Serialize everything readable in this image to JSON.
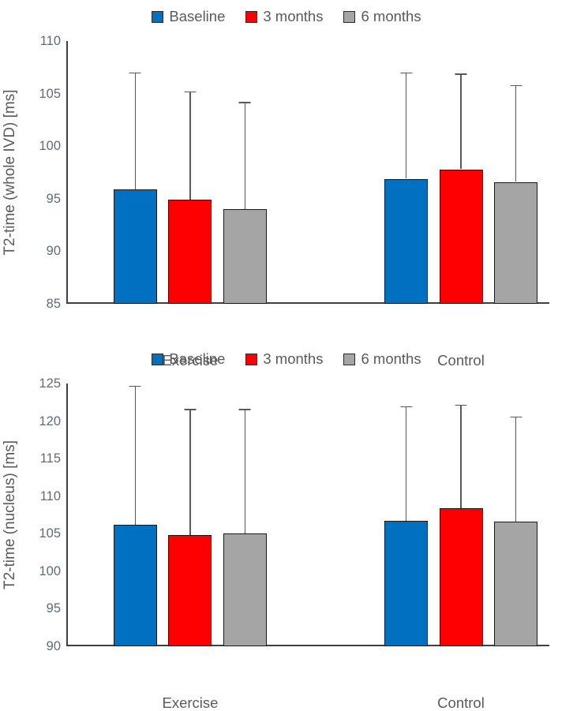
{
  "chart_data": [
    {
      "type": "bar",
      "title": "",
      "xlabel": "",
      "ylabel": "T2-time (whole IVD) [ms]",
      "ylim": [
        85,
        110
      ],
      "yticks": [
        85,
        90,
        95,
        100,
        105,
        110
      ],
      "grid": false,
      "legend_position": "top-center",
      "categories": [
        "Exercise",
        "Control"
      ],
      "series": [
        {
          "name": "Baseline",
          "color": "#0070C0",
          "values": [
            95.9,
            96.9
          ],
          "error_upper": [
            107.0,
            107.0
          ]
        },
        {
          "name": "3 months",
          "color": "#FF0000",
          "values": [
            94.9,
            97.8
          ],
          "error_upper": [
            105.2,
            106.9
          ]
        },
        {
          "name": "6 months",
          "color": "#A5A5A5",
          "values": [
            94.0,
            96.6
          ],
          "error_upper": [
            104.2,
            105.8
          ]
        }
      ]
    },
    {
      "type": "bar",
      "title": "",
      "xlabel": "",
      "ylabel": "T2-time (nucleus) [ms]",
      "ylim": [
        90,
        125
      ],
      "yticks": [
        90,
        95,
        100,
        105,
        110,
        115,
        120,
        125
      ],
      "grid": false,
      "legend_position": "top-center",
      "categories": [
        "Exercise",
        "Control"
      ],
      "series": [
        {
          "name": "Baseline",
          "color": "#0070C0",
          "values": [
            106.2,
            106.7
          ],
          "error_upper": [
            124.7,
            122.0
          ]
        },
        {
          "name": "3 months",
          "color": "#FF0000",
          "values": [
            104.8,
            108.4
          ],
          "error_upper": [
            121.6,
            122.2
          ]
        },
        {
          "name": "6 months",
          "color": "#A5A5A5",
          "values": [
            105.0,
            106.6
          ],
          "error_upper": [
            121.6,
            120.6
          ]
        }
      ]
    }
  ],
  "charts": [
    {
      "id": "chart-whole-ivd",
      "ylabel": "T2-time (whole IVD) [ms]",
      "legend": [
        {
          "label": "Baseline",
          "color": "#0070C0"
        },
        {
          "label": "3 months",
          "color": "#FF0000"
        },
        {
          "label": "6 months",
          "color": "#A5A5A5"
        }
      ],
      "yticks": [
        "110",
        "105",
        "100",
        "95",
        "90",
        "85"
      ],
      "xlabels": [
        "Exercise",
        "Control"
      ]
    },
    {
      "id": "chart-nucleus",
      "ylabel": "T2-time (nucleus) [ms]",
      "legend": [
        {
          "label": "Baseline",
          "color": "#0070C0"
        },
        {
          "label": "3 months",
          "color": "#FF0000"
        },
        {
          "label": "6 months",
          "color": "#A5A5A5"
        }
      ],
      "yticks": [
        "125",
        "120",
        "115",
        "110",
        "105",
        "100",
        "95",
        "90"
      ],
      "xlabels": [
        "Exercise",
        "Control"
      ]
    }
  ]
}
